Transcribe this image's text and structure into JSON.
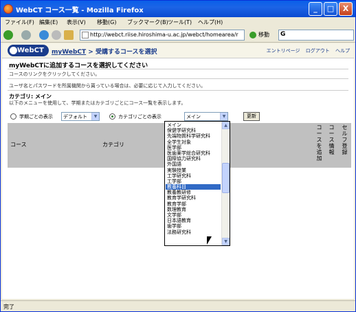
{
  "window": {
    "title": "WebCT コース一覧 - Mozilla Firefox",
    "minimize": "_",
    "maximize": "□",
    "close": "X"
  },
  "menu": [
    "ファイル(F)",
    "編集(E)",
    "表示(V)",
    "移動(G)",
    "ブックマーク(B)",
    "ツール(T)",
    "ヘルプ(H)"
  ],
  "nav": {
    "url": "http://webct.riise.hiroshima-u.ac.jp/webct/homearea/r",
    "go_label": "移動",
    "search_value": "G"
  },
  "webct": {
    "logo": "WebCT",
    "breadcrumb_home": "myWebCT",
    "breadcrumb_sep": " > ",
    "breadcrumb_current": "受講するコースを選択",
    "links": [
      "エントリページ",
      "ログアウト",
      "ヘルプ"
    ]
  },
  "page": {
    "title": "myWebCTに追加するコースを選択してください",
    "instruction1": "コースのリンクをクリックしてください。",
    "instruction2": "ユーザ名とパスワードを所属機関から貰っている場合は、必要に応じて入力してください。",
    "category_label": "カテゴリ: メイン",
    "category_desc": "以下のメニューを使用して、学期またはカテゴリごとにコース一覧を表示します。",
    "radio_term_label": "学期ごとの表示",
    "term_select": "デフォルト",
    "radio_cat_label": "カテゴリごとの表示",
    "cat_select": "メイン",
    "update_button": "更新"
  },
  "table": {
    "col_course": "コース",
    "col_category": "カテゴリ",
    "col_add": "コースを追加",
    "col_info": "コース情報",
    "col_self": "セルフ登録"
  },
  "dropdown": {
    "options": [
      "メイン",
      "保健学研究科",
      "先端物質科学研究科",
      "全学生対象",
      "医学部",
      "医歯薬学総合研究科",
      "国際協力研究科",
      "外国語",
      "実験授業",
      "工学研究科",
      "工学部",
      "教養科目",
      "教養教研修",
      "教育学研究科",
      "教育学部",
      "数理教育",
      "文学部",
      "日本語教育",
      "歯学部",
      "法務研究科"
    ],
    "selected_index": 11
  },
  "status": "完了"
}
